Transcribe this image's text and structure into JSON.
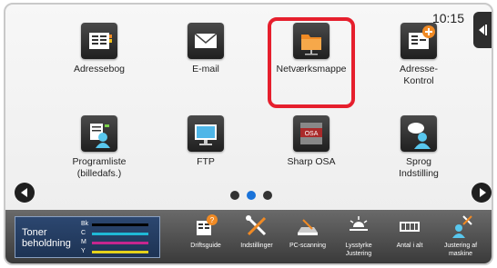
{
  "status": {
    "time": "10:15"
  },
  "tiles": [
    {
      "label": "Adressebog"
    },
    {
      "label": "E-mail"
    },
    {
      "label": "Netværksmappe"
    },
    {
      "label": "Adresse-\nKontrol"
    },
    {
      "label": "Programliste\n(billedafs.)"
    },
    {
      "label": "FTP"
    },
    {
      "label": "Sharp OSA"
    },
    {
      "label": "Sprog\nIndstilling"
    }
  ],
  "pager": {
    "current": 2,
    "total": 3
  },
  "toner": {
    "label": "Toner\nbeholdning",
    "channels": [
      {
        "name": "Bk",
        "color": "#000000"
      },
      {
        "name": "C",
        "color": "#1fb8d6"
      },
      {
        "name": "M",
        "color": "#c6268e"
      },
      {
        "name": "Y",
        "color": "#e4d21b"
      }
    ]
  },
  "bottom_tools": [
    {
      "label": "Driftsguide"
    },
    {
      "label": "Indstillinger"
    },
    {
      "label": "PC-scanning"
    },
    {
      "label": "Lysstyrke\nJustering"
    },
    {
      "label": "Antal i alt"
    },
    {
      "label": "Justering af\nmaskine"
    }
  ],
  "colors": {
    "accent_blue": "#1a73d9",
    "highlight_red": "#e61f2d",
    "folder_orange": "#f08a24"
  }
}
